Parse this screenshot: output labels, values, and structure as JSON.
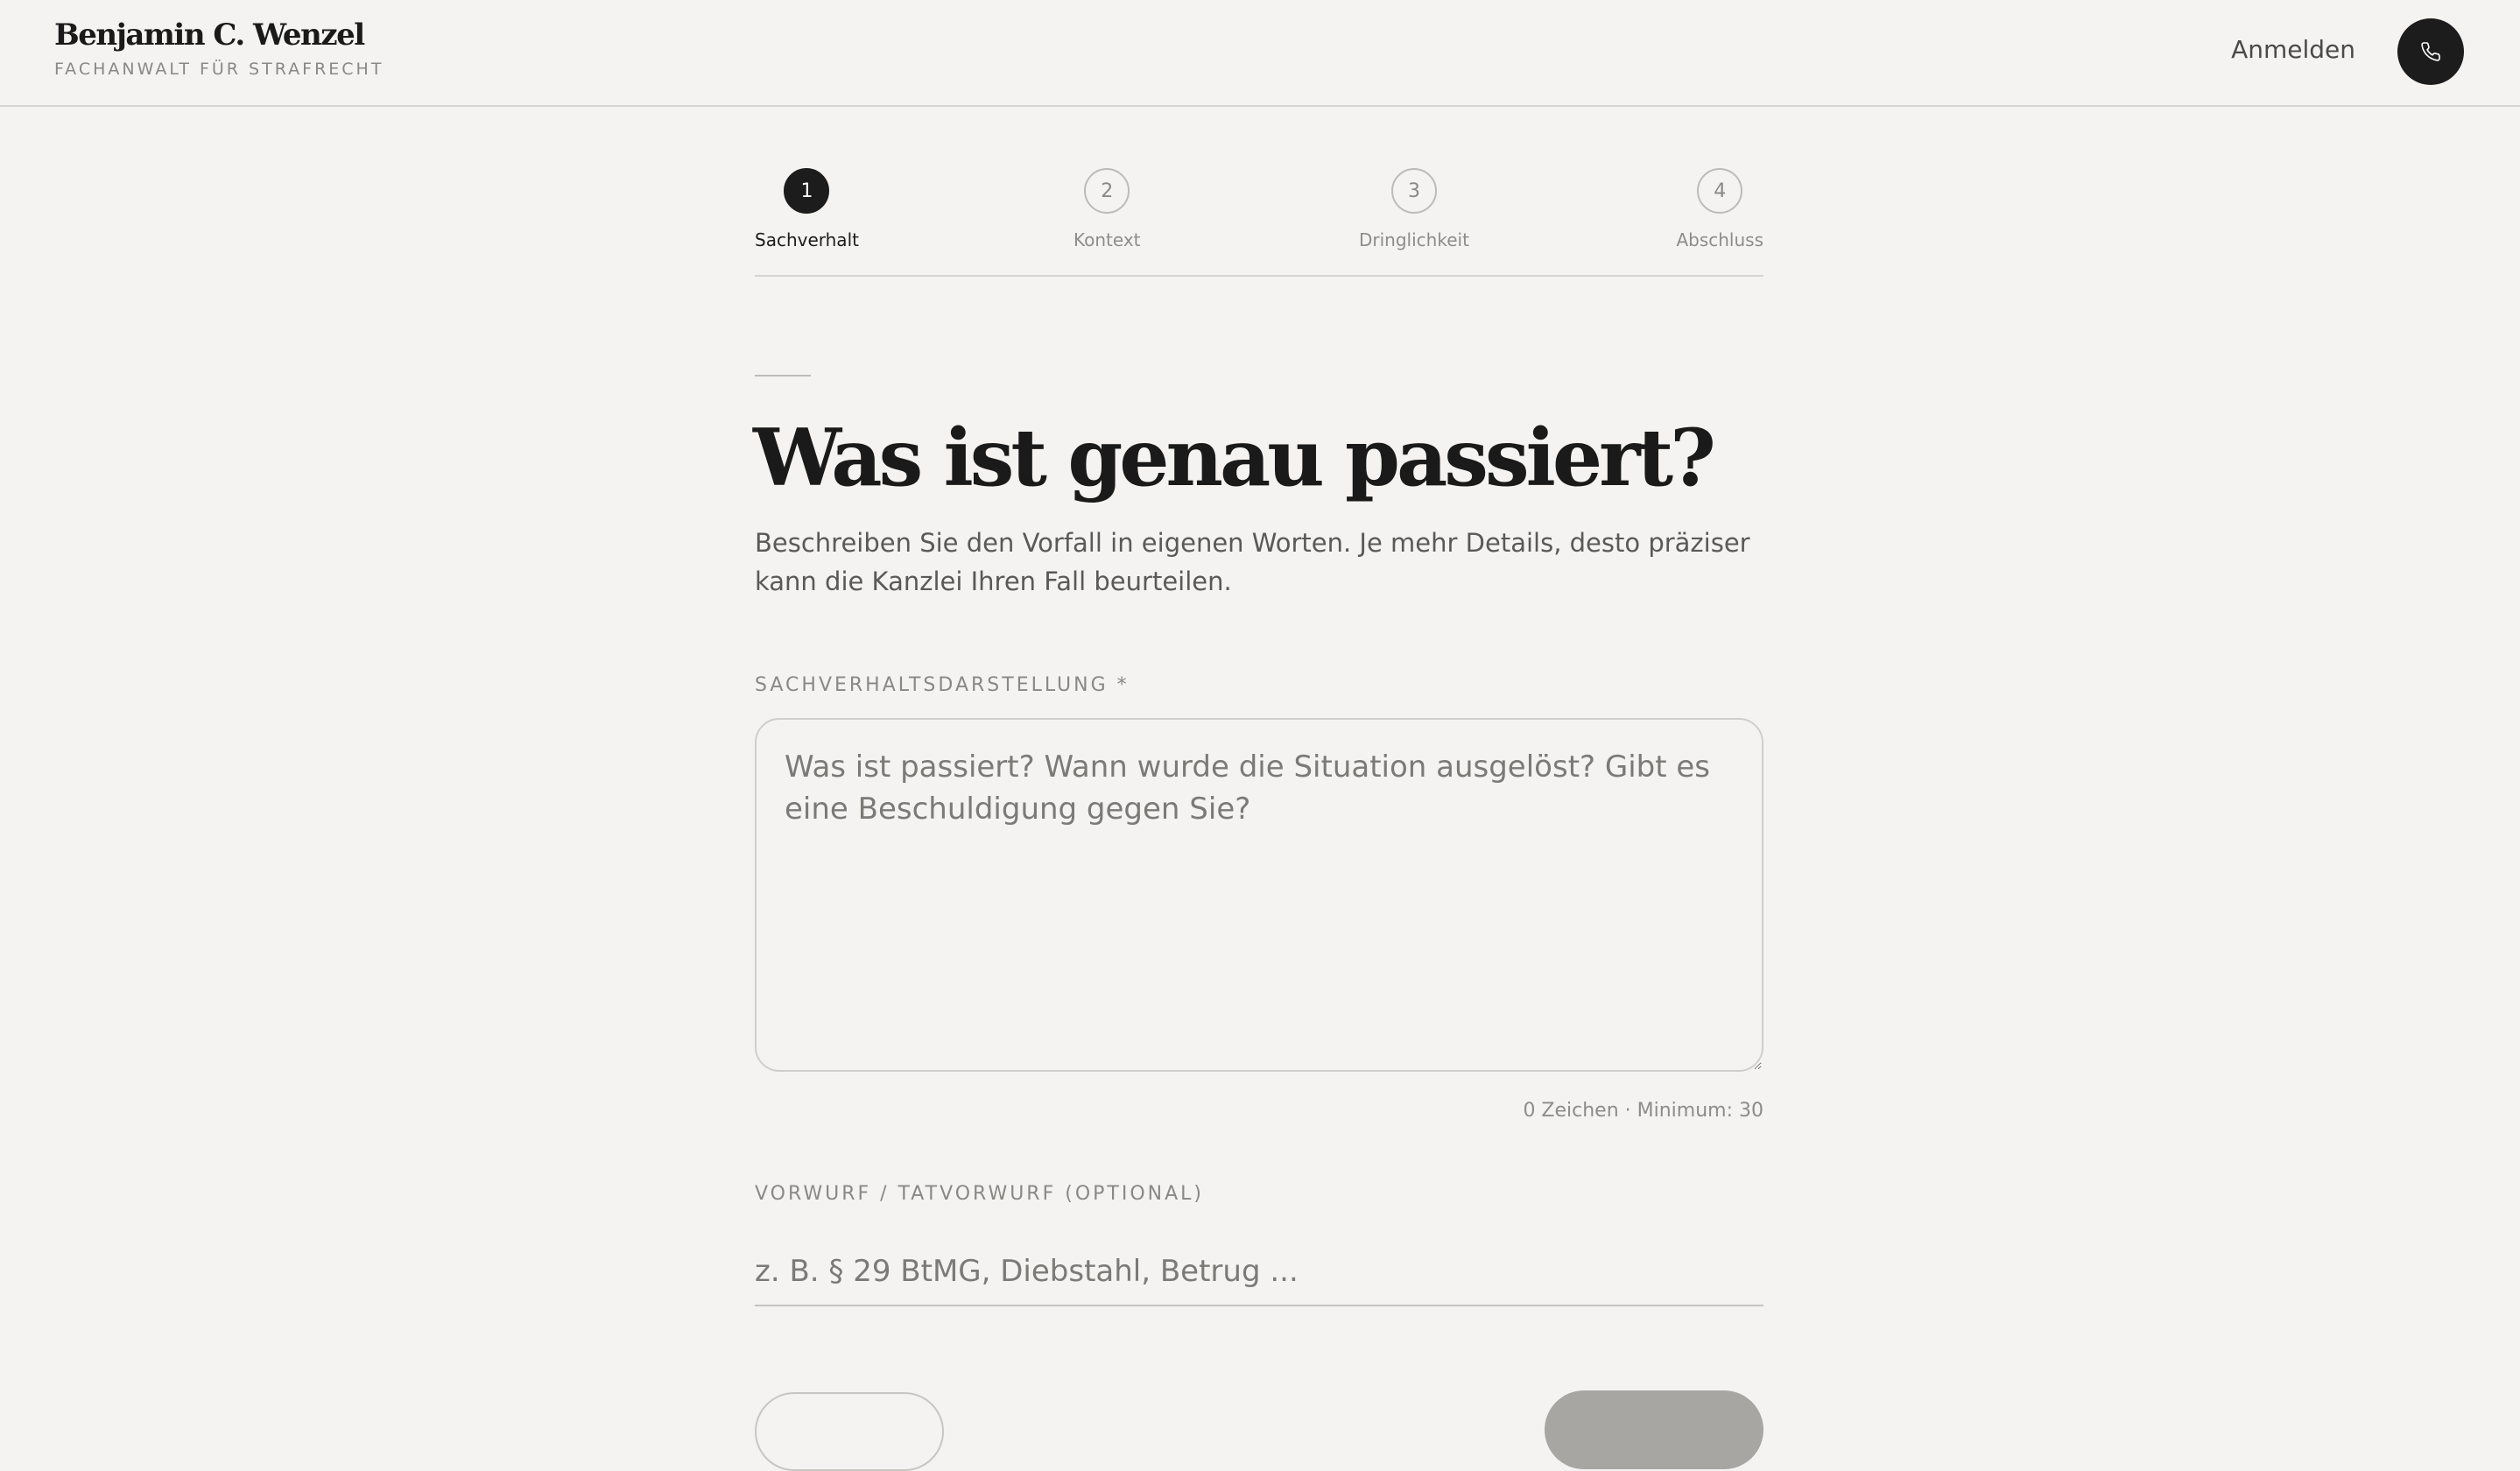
{
  "header": {
    "brand_name": "Benjamin C. Wenzel",
    "brand_subtitle": "FACHANWALT FÜR STRAFRECHT",
    "login_label": "Anmelden",
    "phone_icon": "phone-icon"
  },
  "stepper": {
    "current_step": 1,
    "steps": [
      {
        "number": "1",
        "label": "Sachverhalt"
      },
      {
        "number": "2",
        "label": "Kontext"
      },
      {
        "number": "3",
        "label": "Dringlichkeit"
      },
      {
        "number": "4",
        "label": "Abschluss"
      }
    ]
  },
  "main": {
    "title": "Was ist genau passiert?",
    "description": "Beschreiben Sie den Vorfall in eigenen Worten. Je mehr Details, desto präziser kann die Kanzlei Ihren Fall beurteilen.",
    "statement_label": "SACHVERHALTSDARSTELLUNG *",
    "statement_value": "",
    "statement_placeholder": "Was ist passiert? Wann wurde die Situation ausgelöst? Gibt es eine Beschuldigung gegen Sie?",
    "char_count": "0 Zeichen · Minimum: 30",
    "charge_label": "VORWURF / TATVORWURF (OPTIONAL)",
    "charge_value": "",
    "charge_placeholder": "z. B. § 29 BtMG, Diebstahl, Betrug ..."
  },
  "colors": {
    "background": "#f4f3f1",
    "text_primary": "#1c1c1c",
    "accent_dark": "#1c1c1c",
    "muted": "#8a8884",
    "disabled_button": "#a7a6a3"
  }
}
